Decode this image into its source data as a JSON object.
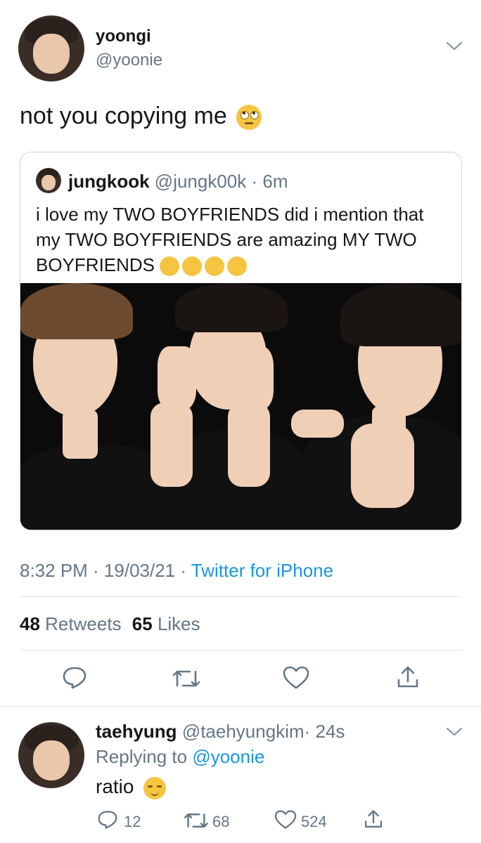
{
  "tweet": {
    "name": "yoongi",
    "handle": "@yoonie",
    "text": "not you copying me",
    "timestamp": "8:32 PM · 19/03/21 · ",
    "source": "Twitter for iPhone",
    "retweets_count": "48",
    "retweets_label": "Retweets",
    "likes_count": "65",
    "likes_label": "Likes"
  },
  "quoted": {
    "name": "jungkook",
    "handle": "@jungk00k",
    "time": "· 6m",
    "text": "i love my TWO BOYFRIENDS did i mention that my TWO BOYFRIENDS are amazing MY TWO BOYFRIENDS"
  },
  "reply": {
    "name": "taehyung",
    "handle": "@taehyungkim",
    "time": "· 24s",
    "replying_label": "Replying to",
    "replying_handle": "@yoonie",
    "text": "ratio",
    "reply_count": "12",
    "retweet_count": "68",
    "like_count": "524"
  },
  "icons": {
    "menu": "chevron-down-icon",
    "reply": "reply-icon",
    "retweet": "retweet-icon",
    "like": "heart-icon",
    "share": "share-icon"
  },
  "colors": {
    "accent": "#1b95e0",
    "muted": "#657786",
    "divider": "#e1e8ed"
  }
}
